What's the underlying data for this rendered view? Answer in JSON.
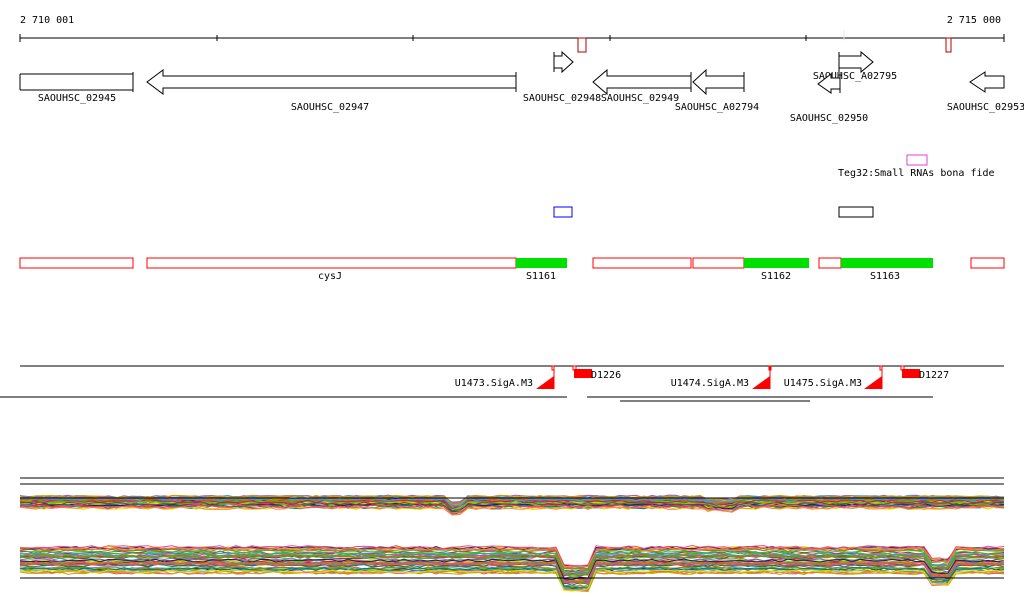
{
  "ruler": {
    "start_label": "2 710 001",
    "end_label": "2 715 000"
  },
  "genes": [
    {
      "id": "SAOUHSC_02945"
    },
    {
      "id": "SAOUHSC_02947"
    },
    {
      "id": "SAOUHSC_02948"
    },
    {
      "id": "SAOUHSC_02949"
    },
    {
      "id": "SAOUHSC_A02794"
    },
    {
      "id": "SAOUHSC_A02795"
    },
    {
      "id": "SAOUHSC_02950"
    },
    {
      "id": "SAOUHSC_02953"
    }
  ],
  "srna": {
    "label": "Teg32:Small RNAs bona fide"
  },
  "transcripts": [
    {
      "label": "cysJ"
    },
    {
      "label": "S1161"
    },
    {
      "label": "S1162"
    },
    {
      "label": "S1163"
    }
  ],
  "promoters": [
    {
      "label": "U1473.SigA.M3"
    },
    {
      "label": "D1226"
    },
    {
      "label": "U1474.SigA.M3"
    },
    {
      "label": "U1475.SigA.M3"
    },
    {
      "label": "D1227"
    }
  ],
  "colors": {
    "gene": "#000000",
    "red": "#ff0000",
    "green": "#00e000",
    "magenta": "#e040e0",
    "blue": "#0000ff",
    "darkred": "#b00000",
    "expression": [
      "#e06030",
      "#a08000",
      "#80c000",
      "#c02060",
      "#6080c0",
      "#40a0e0",
      "#d0a000",
      "#804040",
      "#008060",
      "#ff8040",
      "#a060a0",
      "#202060",
      "#e0e000",
      "#30c030",
      "#ff4080",
      "#808080"
    ]
  }
}
